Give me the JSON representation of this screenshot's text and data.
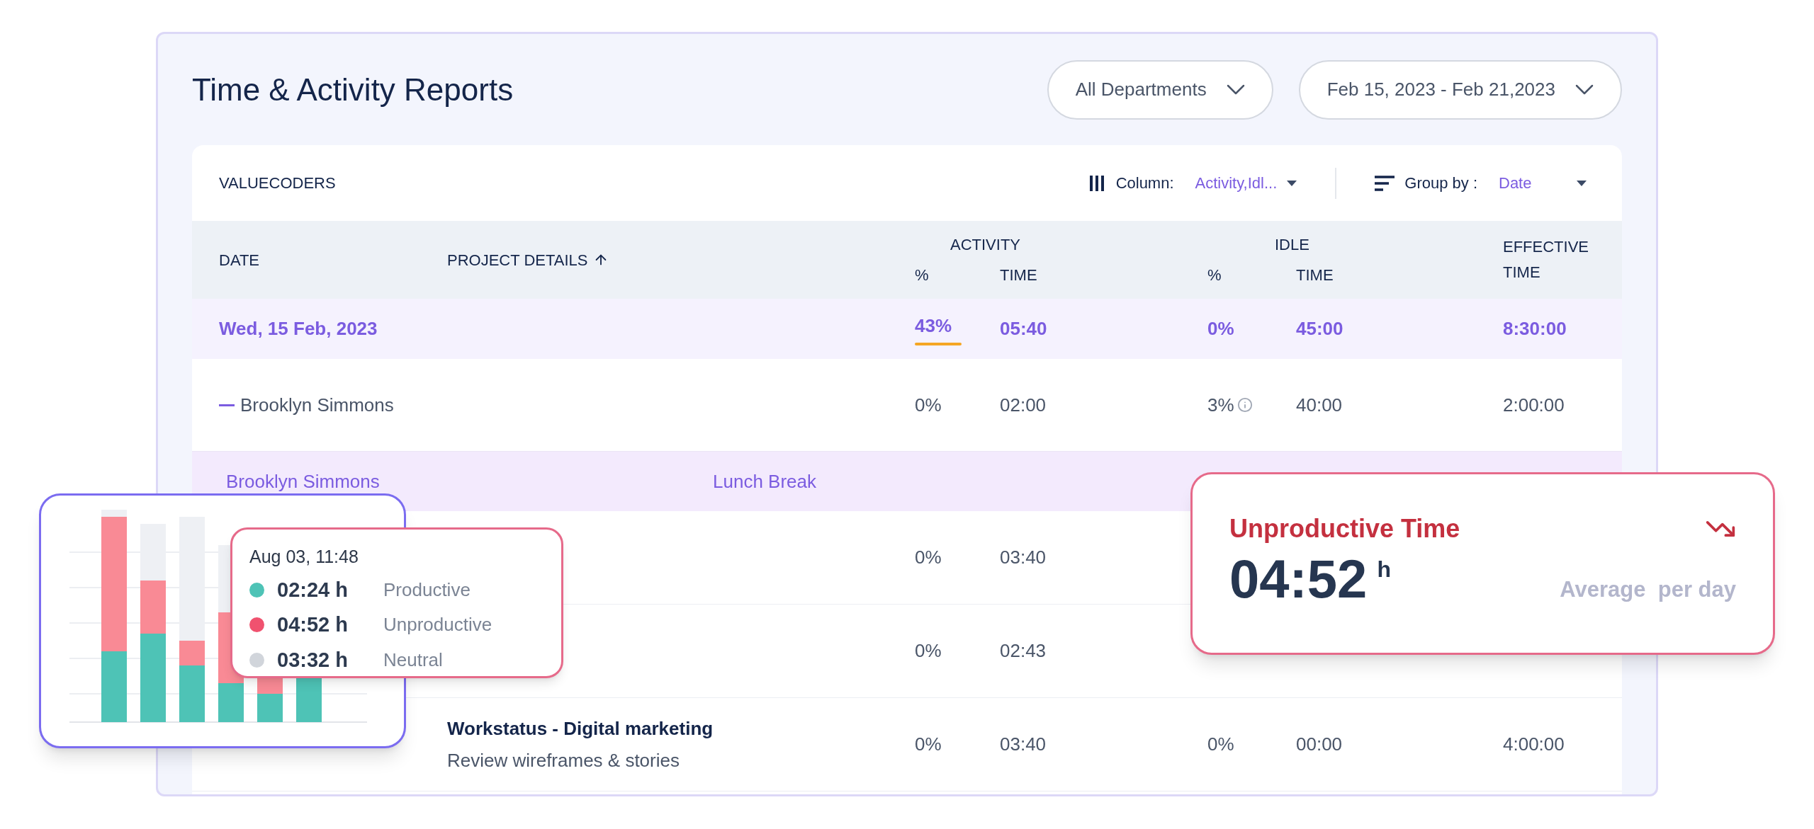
{
  "header": {
    "title": "Time & Activity Reports",
    "filters": [
      {
        "label": "All Departments"
      },
      {
        "label": "Feb 15, 2023 - Feb 21,2023"
      }
    ]
  },
  "table": {
    "company": "VALUECODERS",
    "column_picker": {
      "label": "Column:",
      "value": "Activity,Idl..."
    },
    "group_by": {
      "label": "Group by :",
      "value": "Date"
    },
    "columns": {
      "date": "DATE",
      "project": "PROJECT DETAILS",
      "activity": "ACTIVITY",
      "activity_pct": "%",
      "activity_time": "TIME",
      "idle": "IDLE",
      "idle_pct": "%",
      "idle_time": "TIME",
      "effective": "EFFECTIVE TIME"
    },
    "rows": [
      {
        "kind": "date",
        "date": "Wed, 15 Feb, 2023",
        "activity_pct": "43%",
        "activity_time": "05:40",
        "idle_pct": "0%",
        "idle_time": "45:00",
        "effective": "8:30:00"
      },
      {
        "kind": "member",
        "expanded": true,
        "name": "Brooklyn Simmons",
        "activity_pct": "0%",
        "activity_time": "02:00",
        "idle_pct": "3%",
        "idle_time": "40:00",
        "effective": "2:00:00"
      },
      {
        "kind": "break",
        "name": "Brooklyn Simmons",
        "project": "Lunch Break"
      },
      {
        "kind": "task",
        "activity_pct": "0%",
        "activity_time": "03:40"
      },
      {
        "kind": "task",
        "activity_pct": "0%",
        "activity_time": "02:43"
      },
      {
        "kind": "task",
        "title": "Workstatus - Digital marketing",
        "subtitle": "Review wireframes & stories",
        "activity_pct": "0%",
        "activity_time": "03:40",
        "idle_pct": "0%",
        "idle_time": "00:00",
        "effective": "4:00:00"
      }
    ]
  },
  "chart_card": {
    "tooltip": {
      "time": "Aug 03, 11:48",
      "items": [
        {
          "value": "02:24 h",
          "label": "Productive",
          "color": "#4ec3b6"
        },
        {
          "value": "04:52 h",
          "label": "Unproductive",
          "color": "#f0526f"
        },
        {
          "value": "03:32 h",
          "label": "Neutral",
          "color": "#d1d5db"
        }
      ]
    }
  },
  "stat_card": {
    "title": "Unproductive Time",
    "value": "04:52",
    "unit": "h",
    "caption": "Average  per day"
  }
}
